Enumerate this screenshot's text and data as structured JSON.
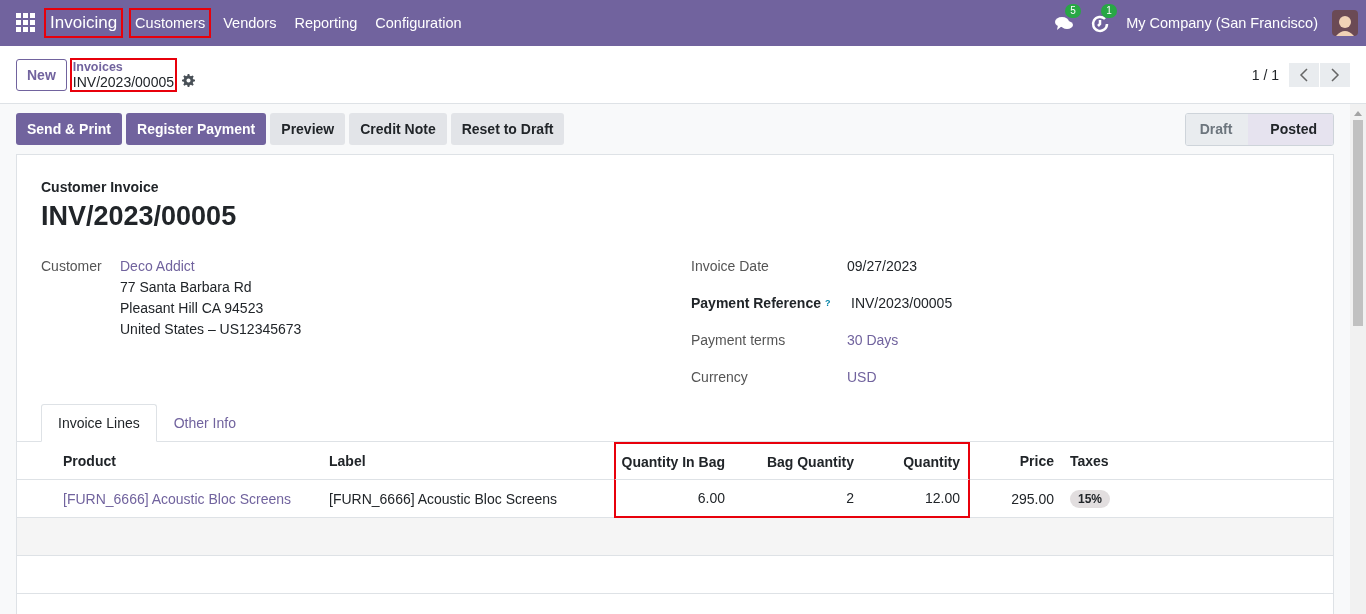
{
  "navbar": {
    "brand": {
      "label": "Invoicing",
      "highlighted": true
    },
    "menu": [
      {
        "label": "Customers",
        "highlighted": true
      },
      {
        "label": "Vendors",
        "highlighted": false
      },
      {
        "label": "Reporting",
        "highlighted": false
      },
      {
        "label": "Configuration",
        "highlighted": false
      }
    ],
    "messages_badge": "5",
    "activities_badge": "1",
    "company": "My Company (San Francisco)"
  },
  "control_panel": {
    "new_button": "New",
    "breadcrumb": {
      "parent": "Invoices",
      "current": "INV/2023/00005",
      "highlighted": true
    },
    "pager": "1 / 1"
  },
  "actions": [
    {
      "label": "Send & Print",
      "kind": "primary"
    },
    {
      "label": "Register Payment",
      "kind": "primary"
    },
    {
      "label": "Preview",
      "kind": "secondary"
    },
    {
      "label": "Credit Note",
      "kind": "secondary"
    },
    {
      "label": "Reset to Draft",
      "kind": "secondary"
    }
  ],
  "status_bar": [
    {
      "label": "Draft",
      "selected": false
    },
    {
      "label": "Posted",
      "selected": true
    }
  ],
  "sheet": {
    "type_label": "Customer Invoice",
    "name": "INV/2023/00005",
    "customer": {
      "label": "Customer",
      "name": "Deco Addict",
      "address": [
        "77 Santa Barbara Rd",
        "Pleasant Hill CA 94523",
        "United States – US12345673"
      ]
    },
    "fields": [
      {
        "label": "Invoice Date",
        "value": "09/27/2023",
        "kind": "plain",
        "required": false
      },
      {
        "label": "Payment Reference",
        "help": "?",
        "value": "INV/2023/00005",
        "kind": "plain",
        "required": true
      },
      {
        "label": "Payment terms",
        "value": "30 Days",
        "kind": "link",
        "required": false
      },
      {
        "label": "Currency",
        "value": "USD",
        "kind": "link",
        "required": false
      }
    ],
    "tabs": [
      {
        "label": "Invoice Lines",
        "selected": true
      },
      {
        "label": "Other Info",
        "selected": false
      }
    ],
    "table": {
      "columns": [
        {
          "label": "Product",
          "kind": "text",
          "highlighted": false
        },
        {
          "label": "Label",
          "kind": "text",
          "highlighted": false
        },
        {
          "label": "Quantity In Bag",
          "kind": "numeric",
          "highlighted": true
        },
        {
          "label": "Bag Quantity",
          "kind": "numeric",
          "highlighted": true
        },
        {
          "label": "Quantity",
          "kind": "numeric",
          "highlighted": true
        },
        {
          "label": "Price",
          "kind": "numeric",
          "highlighted": false
        },
        {
          "label": "Taxes",
          "kind": "text",
          "highlighted": false
        }
      ],
      "rows": [
        [
          {
            "text": "[FURN_6666] Acoustic Bloc Screens",
            "kind": "link"
          },
          {
            "text": "[FURN_6666] Acoustic Bloc Screens",
            "kind": "text"
          },
          {
            "text": "6.00",
            "kind": "text"
          },
          {
            "text": "2",
            "kind": "text"
          },
          {
            "text": "12.00",
            "kind": "text"
          },
          {
            "text": "295.00",
            "kind": "text"
          },
          {
            "text": "15%",
            "kind": "tag"
          }
        ]
      ]
    }
  }
}
